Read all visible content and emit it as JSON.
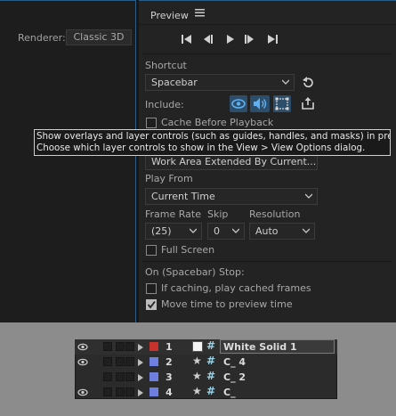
{
  "comp": {
    "renderer_label": "Renderer:",
    "renderer_value": "Classic 3D"
  },
  "preview": {
    "title": "Preview",
    "shortcut_label": "Shortcut",
    "shortcut_value": "Spacebar",
    "include_label": "Include:",
    "cache_before_playback": "Cache Before Playback",
    "range_value": "Work Area Extended By Current...",
    "play_from_label": "Play From",
    "play_from_value": "Current Time",
    "frame_rate_label": "Frame Rate",
    "skip_label": "Skip",
    "resolution_label": "Resolution",
    "frame_rate_value": "(25)",
    "skip_value": "0",
    "resolution_value": "Auto",
    "full_screen": "Full Screen",
    "stop_label": "On (Spacebar) Stop:",
    "if_caching": "If caching, play cached frames",
    "move_time": "Move time to preview time"
  },
  "tooltip": {
    "line1": "Show overlays and layer controls (such as guides, handles, and masks) in preview.",
    "line2": "Choose which layer controls to show in the View > View Options dialog."
  },
  "layers": [
    {
      "num": "1",
      "name": "White Solid 1",
      "color": "#c8322d",
      "visible": true
    },
    {
      "num": "2",
      "name": "C_ 4",
      "color": "#6f7fe0",
      "visible": true
    },
    {
      "num": "3",
      "name": "C_ 2",
      "color": "#6f7fe0",
      "visible": false
    },
    {
      "num": "4",
      "name": "C_",
      "color": "#6f7fe0",
      "visible": true
    }
  ],
  "colors": {
    "accent_blue": "#2c5d86",
    "icon_blue": "#4fa0e6"
  }
}
